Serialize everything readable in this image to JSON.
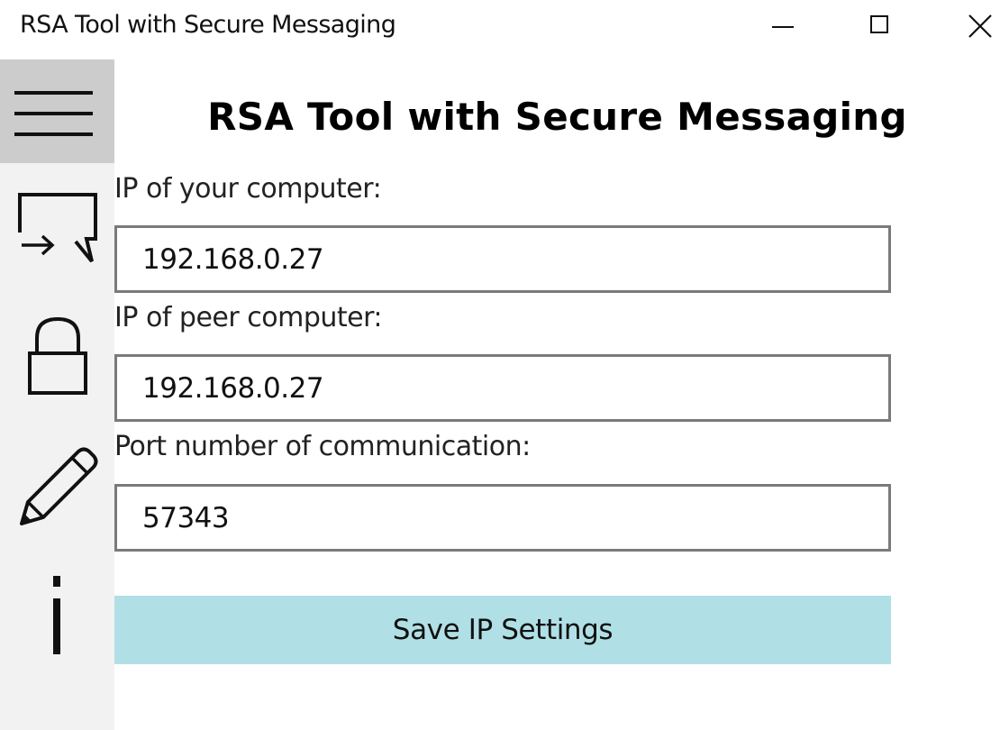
{
  "window": {
    "title": "RSA Tool with Secure Messaging"
  },
  "sidebar": {
    "items": [
      {
        "icon": "hamburger-menu-icon",
        "selected": true
      },
      {
        "icon": "message-incoming-icon",
        "selected": false
      },
      {
        "icon": "lock-icon",
        "selected": false
      },
      {
        "icon": "pencil-icon",
        "selected": false
      },
      {
        "icon": "info-icon",
        "selected": false
      }
    ]
  },
  "main": {
    "heading": "RSA Tool with Secure Messaging",
    "fields": [
      {
        "label": "IP of your computer:",
        "value": "192.168.0.27"
      },
      {
        "label": "IP of peer computer:",
        "value": "192.168.0.27"
      },
      {
        "label": "Port number of communication:",
        "value": "57343"
      }
    ],
    "save_button_label": "Save IP Settings"
  },
  "colors": {
    "sidebar_bg": "#f2f2f2",
    "sidebar_selected_bg": "#cccccc",
    "button_bg": "#b0e0e6",
    "input_border": "#7a7a7a"
  }
}
